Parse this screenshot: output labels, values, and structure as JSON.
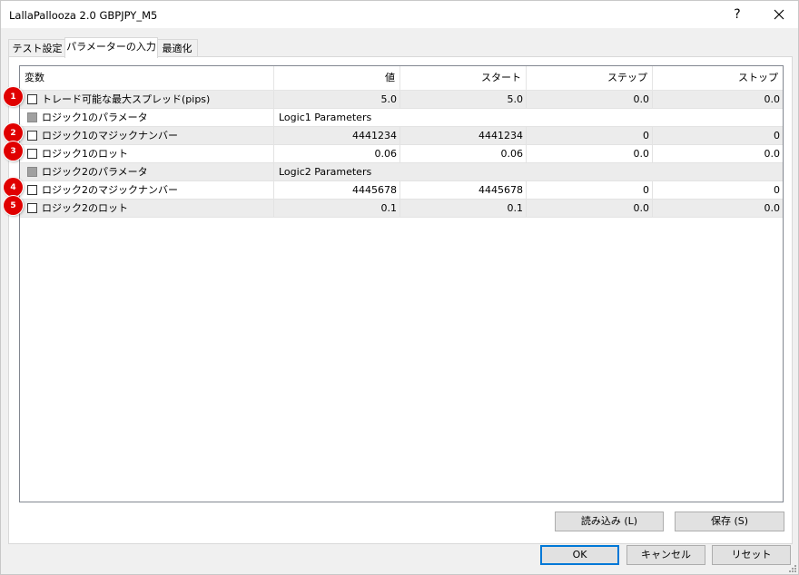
{
  "window": {
    "title": "LallaPallooza 2.0 GBPJPY_M5",
    "help_label": "?"
  },
  "tabs": [
    {
      "label": "テスト設定"
    },
    {
      "label": "パラメーターの入力"
    },
    {
      "label": "最適化"
    }
  ],
  "grid": {
    "columns": [
      "変数",
      "値",
      "スタート",
      "ステップ",
      "ストップ"
    ],
    "rows": [
      {
        "badge": "1",
        "name": "トレード可能な最大スプレッド(pips)",
        "value": "5.0",
        "start": "5.0",
        "step": "0.0",
        "stop": "0.0"
      },
      {
        "badge": "",
        "name": "ロジック1のパラメータ",
        "value": "Logic1 Parameters",
        "start": "",
        "step": "",
        "stop": ""
      },
      {
        "badge": "2",
        "name": "ロジック1のマジックナンバー",
        "value": "4441234",
        "start": "4441234",
        "step": "0",
        "stop": "0"
      },
      {
        "badge": "3",
        "name": "ロジック1のロット",
        "value": "0.06",
        "start": "0.06",
        "step": "0.0",
        "stop": "0.0"
      },
      {
        "badge": "",
        "name": "ロジック2のパラメータ",
        "value": "Logic2 Parameters",
        "start": "",
        "step": "",
        "stop": ""
      },
      {
        "badge": "4",
        "name": "ロジック2のマジックナンバー",
        "value": "4445678",
        "start": "4445678",
        "step": "0",
        "stop": "0"
      },
      {
        "badge": "5",
        "name": "ロジック2のロット",
        "value": "0.1",
        "start": "0.1",
        "step": "0.0",
        "stop": "0.0"
      }
    ]
  },
  "buttons": {
    "load": "読み込み (L)",
    "save": "保存 (S)",
    "ok": "OK",
    "cancel": "キャンセル",
    "reset": "リセット"
  },
  "colors": {
    "badge": "#e00000",
    "focus_border": "#0078d7",
    "shaded_row": "#ececec"
  }
}
